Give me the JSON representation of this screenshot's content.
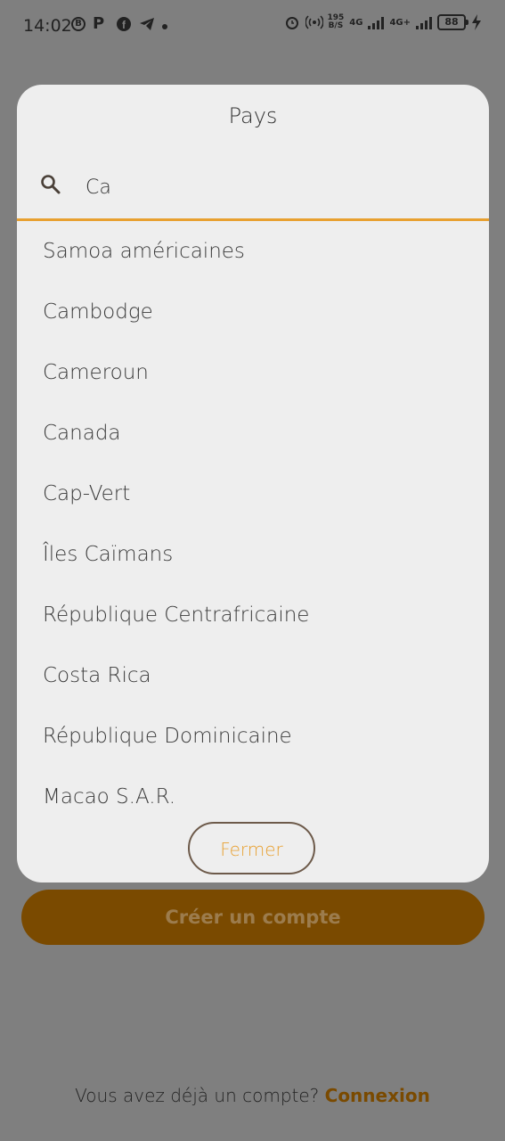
{
  "status_bar": {
    "time": "14:02",
    "net_speed_top": "195",
    "net_speed_bottom": "B/S",
    "signal1_label": "4G",
    "signal2_label": "4G+",
    "battery": "88"
  },
  "dialog": {
    "title": "Pays",
    "search": {
      "value": "Ca"
    },
    "countries": [
      "Samoa américaines",
      "Cambodge",
      "Cameroun",
      "Canada",
      "Cap-Vert",
      "Îles Caïmans",
      "République Centrafricaine",
      "Costa Rica",
      "République Dominicaine",
      "Macao S.A.R."
    ],
    "close_label": "Fermer"
  },
  "background": {
    "create_account_label": "Créer un compte",
    "login_prompt": "Vous avez déjà un compte?",
    "login_link": "Connexion"
  },
  "colors": {
    "accent": "#e8a030",
    "primary": "#7a4a00",
    "dialog_bg": "#eeeeee",
    "scrim": "#7f7f7f"
  }
}
